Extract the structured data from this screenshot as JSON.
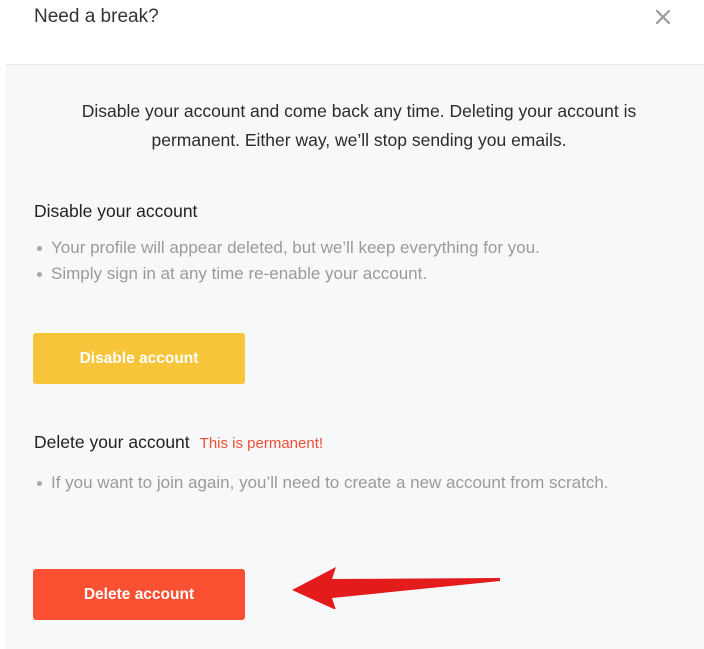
{
  "dialog": {
    "title": "Need a break?",
    "close_icon": "close-icon",
    "intro": "Disable your account and come back any time. Deleting your account is permanent. Either way, we’ll stop sending you emails."
  },
  "disable_section": {
    "title": "Disable your account",
    "bullets": [
      "Your profile will appear deleted, but we’ll keep everything for you.",
      "Simply sign in at any time re-enable your account."
    ],
    "button_label": "Disable account",
    "button_color": "#f7c43a"
  },
  "delete_section": {
    "title": "Delete your account",
    "warning": "This is permanent!",
    "warning_color": "#f04e34",
    "bullets": [
      "If you want to join again, you’ll need to create a new account from scratch."
    ],
    "button_label": "Delete account",
    "button_color": "#fb5132"
  },
  "annotation": {
    "arrow_icon": "red-arrow-icon",
    "arrow_color": "#e31b1b"
  }
}
